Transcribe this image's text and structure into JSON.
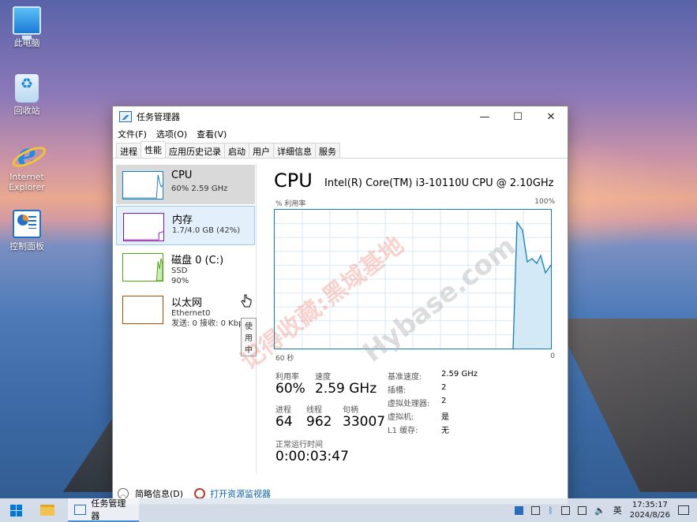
{
  "desktop": {
    "icons": [
      {
        "label": "此电脑",
        "icon": "computer-icon"
      },
      {
        "label": "回收站",
        "icon": "recycle-bin-icon"
      },
      {
        "label": "Internet Explorer",
        "icon": "ie-icon"
      },
      {
        "label": "控制面板",
        "icon": "control-panel-icon"
      }
    ]
  },
  "window": {
    "title": "任务管理器",
    "menu": [
      "文件(F)",
      "选项(O)",
      "查看(V)"
    ],
    "tabs": [
      "进程",
      "性能",
      "应用历史记录",
      "启动",
      "用户",
      "详细信息",
      "服务"
    ],
    "active_tab": "性能"
  },
  "sidebar": {
    "items": [
      {
        "name": "CPU",
        "sub1": "60% 2.59 GHz",
        "sub2": "",
        "color": "#117dbb"
      },
      {
        "name": "内存",
        "sub1": "1.7/4.0 GB (42%)",
        "sub2": "",
        "color": "#8b12ae"
      },
      {
        "name": "磁盘 0 (C:)",
        "sub1": "SSD",
        "sub2": "90%",
        "color": "#4da60c"
      },
      {
        "name": "以太网",
        "sub1": "Ethernet0",
        "sub2": "发送: 0 接收: 0 Kbps",
        "color": "#a74f01"
      }
    ],
    "tooltip": "使用中"
  },
  "main": {
    "title": "CPU",
    "model": "Intel(R) Core(TM) i3-10110U CPU @ 2.10GHz",
    "graph_label_left": "% 利用率",
    "graph_label_right": "100%",
    "axis_left": "60 秒",
    "axis_right": "0",
    "stats": {
      "utilization_label": "利用率",
      "utilization": "60%",
      "speed_label": "速度",
      "speed": "2.59 GHz",
      "processes_label": "进程",
      "processes": "64",
      "threads_label": "线程",
      "threads": "962",
      "handles_label": "句柄",
      "handles": "33007",
      "uptime_label": "正常运行时间",
      "uptime": "0:00:03:47"
    },
    "details": [
      {
        "k": "基准速度:",
        "v": "2.59 GHz"
      },
      {
        "k": "插槽:",
        "v": "2"
      },
      {
        "k": "虚拟处理器:",
        "v": "2"
      },
      {
        "k": "虚拟机:",
        "v": "是"
      },
      {
        "k": "L1 缓存:",
        "v": "无"
      }
    ]
  },
  "footer": {
    "brief": "简略信息(D)",
    "resmon": "打开资源监视器"
  },
  "watermarks": [
    "记得收藏:黑域基地",
    "Hybase.com"
  ],
  "taskbar": {
    "task_label": "任务管理器",
    "ime": "英",
    "time": "17:35:17",
    "date": "2024/8/26"
  }
}
